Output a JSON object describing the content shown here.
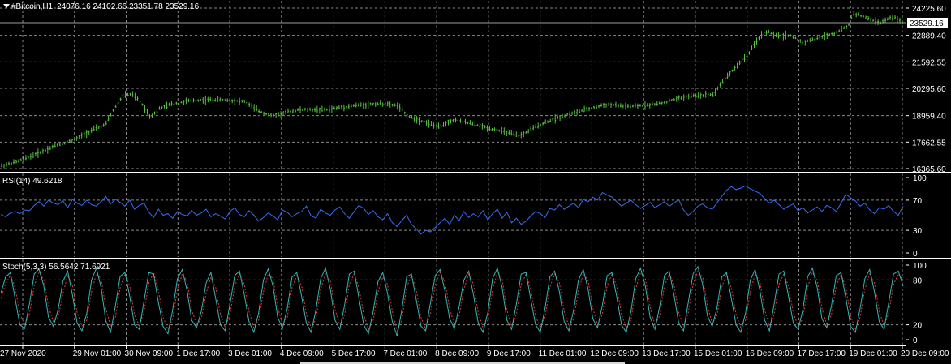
{
  "chart_data": [
    {
      "type": "bar",
      "subtype": "ohlc",
      "title": "#Bitcoin,H1",
      "title_icon": "triangle-down-icon",
      "ohlc_header": "24076.16 24102.66 23351.78 23529.16",
      "current_price_label": "23529.16",
      "ylim": [
        16365.6,
        24225.6
      ],
      "ytick_labels": [
        "24225.60",
        "22889.40",
        "21592.55",
        "20295.60",
        "18959.40",
        "17662.55",
        "16365.60"
      ],
      "yticks": [
        24225.6,
        22889.4,
        21592.55,
        20295.6,
        18959.4,
        17662.55,
        16365.6
      ],
      "bar_color": "#58c23f",
      "grid": true,
      "close_series": [
        {
          "x": 0.0,
          "y": 16500
        },
        {
          "x": 0.02,
          "y": 16750
        },
        {
          "x": 0.04,
          "y": 17100
        },
        {
          "x": 0.06,
          "y": 17500
        },
        {
          "x": 0.08,
          "y": 17750
        },
        {
          "x": 0.1,
          "y": 18250
        },
        {
          "x": 0.115,
          "y": 18500
        },
        {
          "x": 0.125,
          "y": 19300
        },
        {
          "x": 0.135,
          "y": 19950
        },
        {
          "x": 0.145,
          "y": 20000
        },
        {
          "x": 0.155,
          "y": 19600
        },
        {
          "x": 0.165,
          "y": 18900
        },
        {
          "x": 0.175,
          "y": 19300
        },
        {
          "x": 0.19,
          "y": 19550
        },
        {
          "x": 0.21,
          "y": 19700
        },
        {
          "x": 0.24,
          "y": 19750
        },
        {
          "x": 0.27,
          "y": 19650
        },
        {
          "x": 0.285,
          "y": 19200
        },
        {
          "x": 0.3,
          "y": 18950
        },
        {
          "x": 0.33,
          "y": 19250
        },
        {
          "x": 0.36,
          "y": 19250
        },
        {
          "x": 0.39,
          "y": 19450
        },
        {
          "x": 0.42,
          "y": 19550
        },
        {
          "x": 0.44,
          "y": 19450
        },
        {
          "x": 0.45,
          "y": 18950
        },
        {
          "x": 0.47,
          "y": 18650
        },
        {
          "x": 0.485,
          "y": 18400
        },
        {
          "x": 0.5,
          "y": 18750
        },
        {
          "x": 0.52,
          "y": 18600
        },
        {
          "x": 0.54,
          "y": 18350
        },
        {
          "x": 0.56,
          "y": 18150
        },
        {
          "x": 0.575,
          "y": 17950
        },
        {
          "x": 0.59,
          "y": 18350
        },
        {
          "x": 0.605,
          "y": 18650
        },
        {
          "x": 0.62,
          "y": 18900
        },
        {
          "x": 0.64,
          "y": 19150
        },
        {
          "x": 0.67,
          "y": 19500
        },
        {
          "x": 0.7,
          "y": 19400
        },
        {
          "x": 0.73,
          "y": 19550
        },
        {
          "x": 0.76,
          "y": 19900
        },
        {
          "x": 0.79,
          "y": 20000
        },
        {
          "x": 0.8,
          "y": 20600
        },
        {
          "x": 0.815,
          "y": 21350
        },
        {
          "x": 0.83,
          "y": 22000
        },
        {
          "x": 0.84,
          "y": 22750
        },
        {
          "x": 0.85,
          "y": 23100
        },
        {
          "x": 0.86,
          "y": 22850
        },
        {
          "x": 0.875,
          "y": 22900
        },
        {
          "x": 0.89,
          "y": 22550
        },
        {
          "x": 0.905,
          "y": 22750
        },
        {
          "x": 0.925,
          "y": 23000
        },
        {
          "x": 0.94,
          "y": 23350
        },
        {
          "x": 0.945,
          "y": 24000
        },
        {
          "x": 0.96,
          "y": 23750
        },
        {
          "x": 0.975,
          "y": 23500
        },
        {
          "x": 0.99,
          "y": 23800
        },
        {
          "x": 1.0,
          "y": 23529.16
        }
      ]
    },
    {
      "type": "line",
      "title": "RSI(14) 49.6218",
      "ylim": [
        0,
        100
      ],
      "ytick_labels": [
        "100",
        "70",
        "30",
        "0"
      ],
      "yticks": [
        100,
        70,
        30,
        0
      ],
      "line_color": "#3a6cf0",
      "grid": true,
      "series": [
        {
          "values": [
            51,
            48,
            53,
            55,
            52,
            57,
            56,
            63,
            68,
            62,
            70,
            66,
            64,
            69,
            60,
            71,
            66,
            63,
            70,
            64,
            62,
            68,
            75,
            65,
            71,
            67,
            62,
            70,
            58,
            63,
            66,
            54,
            47,
            58,
            50,
            52,
            46,
            55,
            51,
            49,
            56,
            50,
            53,
            58,
            48,
            52,
            49,
            45,
            55,
            60,
            51,
            48,
            56,
            50,
            42,
            47,
            53,
            49,
            44,
            57,
            54,
            48,
            52,
            55,
            62,
            49,
            46,
            58,
            53,
            50,
            57,
            61,
            52,
            46,
            55,
            63,
            59,
            51,
            56,
            48,
            44,
            52,
            40,
            35,
            43,
            50,
            38,
            32,
            25,
            30,
            28,
            34,
            40,
            46,
            38,
            50,
            43,
            55,
            47,
            52,
            48,
            56,
            44,
            52,
            58,
            46,
            54,
            40,
            46,
            38,
            42,
            49,
            55,
            52,
            47,
            59,
            57,
            64,
            58,
            62,
            66,
            60,
            71,
            68,
            74,
            70,
            80,
            77,
            74,
            68,
            62,
            66,
            70,
            64,
            59,
            63,
            67,
            60,
            64,
            68,
            62,
            66,
            71,
            57,
            50,
            55,
            62,
            65,
            60,
            58,
            66,
            75,
            83,
            88,
            84,
            86,
            89,
            85,
            82,
            79,
            72,
            66,
            70,
            64,
            58,
            62,
            65,
            56,
            60,
            53,
            57,
            61,
            55,
            63,
            60,
            55,
            66,
            78,
            73,
            69,
            62,
            66,
            57,
            52,
            60,
            58,
            63,
            55,
            50,
            62
          ]
        }
      ]
    },
    {
      "type": "line",
      "title": "Stoch(5,3,3) 56.5642 71.6921",
      "ylim": [
        0,
        100
      ],
      "ytick_labels": [
        "100",
        "80",
        "20",
        "0"
      ],
      "yticks": [
        100,
        80,
        20,
        0
      ],
      "grid": true,
      "series": [
        {
          "name_color": "main",
          "color": "#3ab5b5",
          "values": [
            62,
            84,
            90,
            55,
            20,
            15,
            48,
            88,
            95,
            72,
            30,
            18,
            40,
            78,
            92,
            60,
            22,
            12,
            35,
            80,
            96,
            70,
            25,
            10,
            45,
            85,
            90,
            58,
            20,
            14,
            52,
            90,
            88,
            50,
            18,
            8,
            40,
            82,
            94,
            66,
            26,
            16,
            38,
            76,
            90,
            55,
            20,
            12,
            48,
            86,
            92,
            60,
            24,
            10,
            36,
            80,
            95,
            72,
            30,
            15,
            42,
            84,
            90,
            58,
            22,
            10,
            40,
            82,
            96,
            68,
            26,
            14,
            46,
            88,
            92,
            56,
            20,
            8,
            38,
            78,
            90,
            62,
            24,
            5,
            40,
            84,
            88,
            54,
            18,
            12,
            50,
            86,
            94,
            66,
            28,
            15,
            44,
            80,
            92,
            60,
            22,
            10,
            36,
            82,
            96,
            70,
            26,
            14,
            48,
            88,
            90,
            54,
            20,
            10,
            42,
            84,
            92,
            64,
            24,
            12,
            40,
            80,
            94,
            68,
            28,
            16,
            46,
            86,
            90,
            58,
            20,
            10,
            38,
            82,
            96,
            72,
            30,
            14,
            44,
            86,
            92,
            60,
            22,
            12,
            50,
            88,
            98,
            74,
            32,
            18,
            42,
            84,
            90,
            56,
            20,
            10,
            36,
            80,
            94,
            66,
            26,
            12,
            48,
            88,
            92,
            58,
            22,
            14,
            40,
            84,
            96,
            70,
            28,
            16,
            46,
            86,
            90,
            56,
            18,
            10,
            42,
            82,
            94,
            64,
            24,
            14,
            50,
            88,
            92,
            72
          ]
        },
        {
          "name_color": "signal",
          "color": "#e03a3a",
          "dash": true,
          "values": [
            55,
            75,
            86,
            70,
            35,
            20,
            35,
            72,
            90,
            80,
            45,
            24,
            30,
            62,
            86,
            72,
            36,
            18,
            26,
            64,
            88,
            82,
            42,
            18,
            30,
            70,
            88,
            72,
            34,
            18,
            38,
            76,
            90,
            66,
            30,
            14,
            28,
            68,
            88,
            78,
            40,
            20,
            28,
            62,
            84,
            70,
            34,
            16,
            34,
            72,
            88,
            74,
            38,
            16,
            26,
            64,
            88,
            82,
            44,
            20,
            30,
            70,
            86,
            72,
            34,
            16,
            28,
            68,
            88,
            80,
            40,
            20,
            32,
            74,
            88,
            70,
            34,
            14,
            26,
            64,
            84,
            74,
            38,
            12,
            26,
            70,
            86,
            68,
            30,
            14,
            36,
            74,
            90,
            78,
            42,
            20,
            32,
            68,
            88,
            74,
            36,
            16,
            26,
            66,
            90,
            82,
            40,
            18,
            34,
            74,
            88,
            68,
            32,
            16,
            30,
            70,
            88,
            76,
            38,
            18,
            28,
            66,
            88,
            80,
            42,
            20,
            34,
            72,
            88,
            72,
            34,
            16,
            26,
            68,
            90,
            82,
            44,
            20,
            32,
            72,
            88,
            74,
            36,
            18,
            36,
            74,
            92,
            84,
            46,
            22,
            32,
            70,
            88,
            70,
            34,
            16,
            26,
            64,
            88,
            78,
            40,
            18,
            34,
            74,
            88,
            72,
            36,
            18,
            28,
            70,
            90,
            80,
            42,
            20,
            34,
            72,
            88,
            70,
            32,
            14,
            30,
            68,
            88,
            76,
            38,
            18,
            36,
            74,
            88,
            80
          ]
        }
      ]
    }
  ],
  "time_axis": {
    "labels": [
      "27 Nov 2020",
      "29 Nov 01:00",
      "30 Nov 09:00",
      "1 Dec 17:00",
      "3 Dec 01:00",
      "4 Dec 09:00",
      "5 Dec 17:00",
      "7 Dec 01:00",
      "8 Dec 09:00",
      "9 Dec 17:00",
      "11 Dec 01:00",
      "12 Dec 09:00",
      "13 Dec 17:00",
      "15 Dec 01:00",
      "16 Dec 09:00",
      "17 Dec 17:00",
      "19 Dec 01:00",
      "20 Dec 09:00"
    ]
  },
  "colors": {
    "background": "#000000",
    "grid": "#8a8a8a",
    "text": "#ffffff"
  }
}
